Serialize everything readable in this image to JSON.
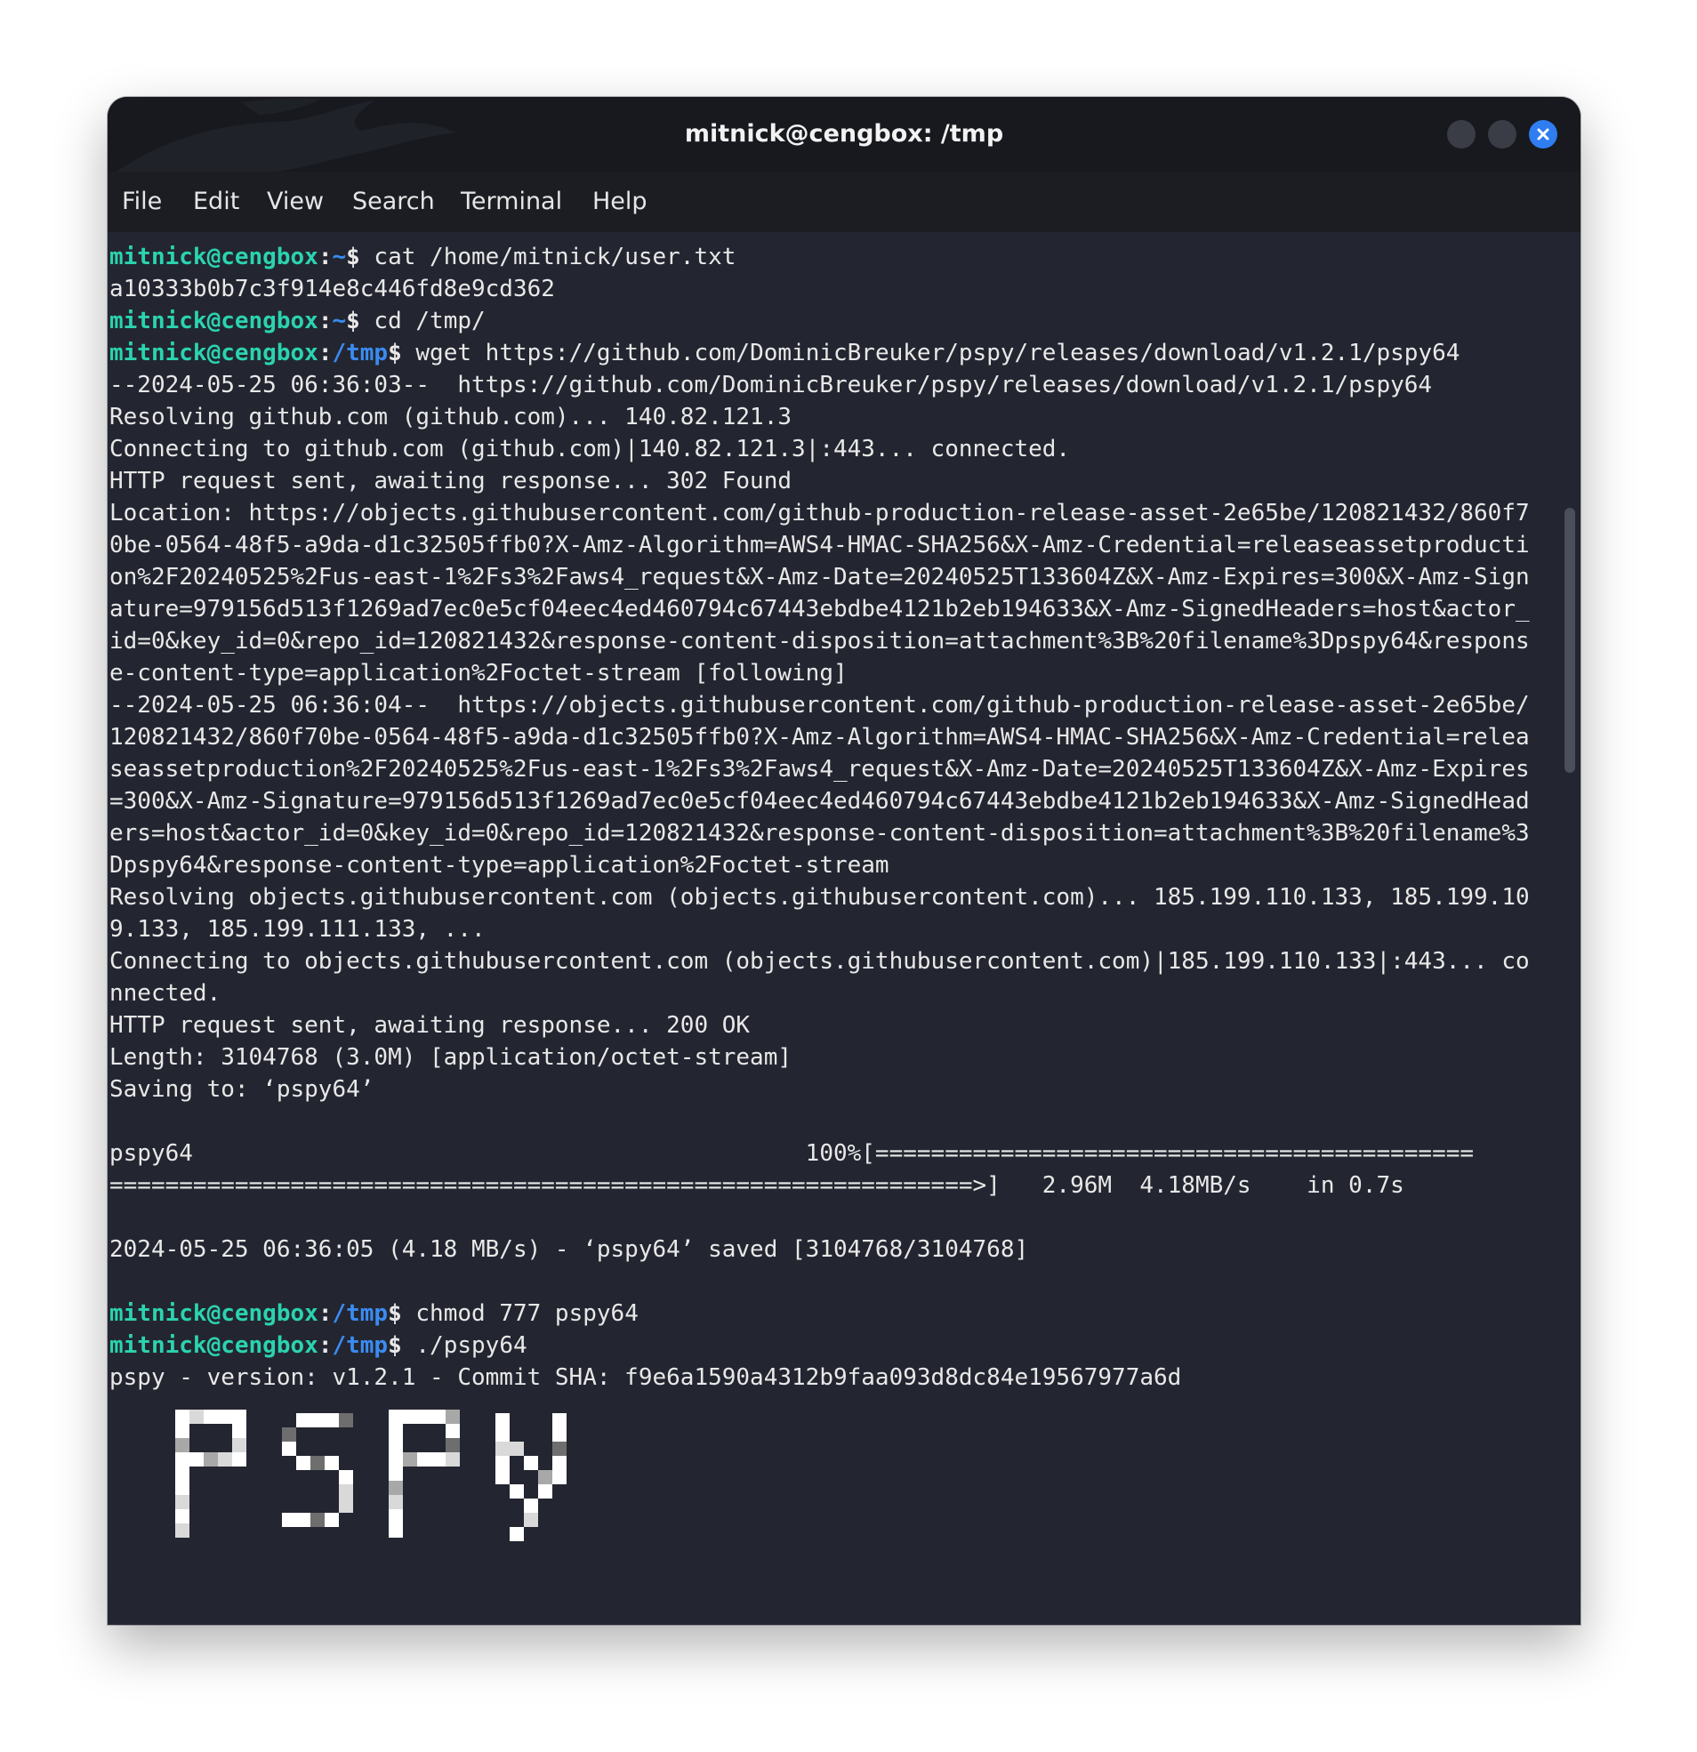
{
  "window": {
    "title": "mitnick@cengbox: /tmp",
    "accent_color": "#2f7df0"
  },
  "menu": [
    "File",
    "Edit",
    "View",
    "Search",
    "Terminal",
    "Help"
  ],
  "terminal": {
    "prompt_user": "mitnick@cengbox",
    "prompt_color": "#2bd3b0",
    "path_color": "#3b8bf2",
    "lines": [
      {
        "type": "prompt",
        "path": "~",
        "cmd": " cat /home/mitnick/user.txt"
      },
      {
        "type": "out",
        "text": "a10333b0b7c3f914e8c446fd8e9cd362"
      },
      {
        "type": "prompt",
        "path": "~",
        "cmd": " cd /tmp/"
      },
      {
        "type": "prompt",
        "path": "/tmp",
        "cmd": " wget https://github.com/DominicBreuker/pspy/releases/download/v1.2.1/pspy64"
      },
      {
        "type": "out",
        "text": "--2024-05-25 06:36:03--  https://github.com/DominicBreuker/pspy/releases/download/v1.2.1/pspy64"
      },
      {
        "type": "out",
        "text": "Resolving github.com (github.com)... 140.82.121.3"
      },
      {
        "type": "out",
        "text": "Connecting to github.com (github.com)|140.82.121.3|:443... connected."
      },
      {
        "type": "out",
        "text": "HTTP request sent, awaiting response... 302 Found"
      },
      {
        "type": "out",
        "text": "Location: https://objects.githubusercontent.com/github-production-release-asset-2e65be/120821432/860f7"
      },
      {
        "type": "out",
        "text": "0be-0564-48f5-a9da-d1c32505ffb0?X-Amz-Algorithm=AWS4-HMAC-SHA256&X-Amz-Credential=releaseassetproducti"
      },
      {
        "type": "out",
        "text": "on%2F20240525%2Fus-east-1%2Fs3%2Faws4_request&X-Amz-Date=20240525T133604Z&X-Amz-Expires=300&X-Amz-Sign"
      },
      {
        "type": "out",
        "text": "ature=979156d513f1269ad7ec0e5cf04eec4ed460794c67443ebdbe4121b2eb194633&X-Amz-SignedHeaders=host&actor_"
      },
      {
        "type": "out",
        "text": "id=0&key_id=0&repo_id=120821432&response-content-disposition=attachment%3B%20filename%3Dpspy64&respons"
      },
      {
        "type": "out",
        "text": "e-content-type=application%2Foctet-stream [following]"
      },
      {
        "type": "out",
        "text": "--2024-05-25 06:36:04--  https://objects.githubusercontent.com/github-production-release-asset-2e65be/"
      },
      {
        "type": "out",
        "text": "120821432/860f70be-0564-48f5-a9da-d1c32505ffb0?X-Amz-Algorithm=AWS4-HMAC-SHA256&X-Amz-Credential=relea"
      },
      {
        "type": "out",
        "text": "seassetproduction%2F20240525%2Fus-east-1%2Fs3%2Faws4_request&X-Amz-Date=20240525T133604Z&X-Amz-Expires"
      },
      {
        "type": "out",
        "text": "=300&X-Amz-Signature=979156d513f1269ad7ec0e5cf04eec4ed460794c67443ebdbe4121b2eb194633&X-Amz-SignedHead"
      },
      {
        "type": "out",
        "text": "ers=host&actor_id=0&key_id=0&repo_id=120821432&response-content-disposition=attachment%3B%20filename%3"
      },
      {
        "type": "out",
        "text": "Dpspy64&response-content-type=application%2Foctet-stream"
      },
      {
        "type": "out",
        "text": "Resolving objects.githubusercontent.com (objects.githubusercontent.com)... 185.199.110.133, 185.199.10"
      },
      {
        "type": "out",
        "text": "9.133, 185.199.111.133, ..."
      },
      {
        "type": "out",
        "text": "Connecting to objects.githubusercontent.com (objects.githubusercontent.com)|185.199.110.133|:443... co"
      },
      {
        "type": "out",
        "text": "nnected."
      },
      {
        "type": "out",
        "text": "HTTP request sent, awaiting response... 200 OK"
      },
      {
        "type": "out",
        "text": "Length: 3104768 (3.0M) [application/octet-stream]"
      },
      {
        "type": "out",
        "text": "Saving to: ‘pspy64’"
      },
      {
        "type": "out",
        "text": ""
      },
      {
        "type": "out",
        "text": "pspy64                                            100%[==========================================="
      },
      {
        "type": "out",
        "text": "==============================================================>]   2.96M  4.18MB/s    in 0.7s"
      },
      {
        "type": "out",
        "text": ""
      },
      {
        "type": "out",
        "text": "2024-05-25 06:36:05 (4.18 MB/s) - ‘pspy64’ saved [3104768/3104768]"
      },
      {
        "type": "out",
        "text": ""
      },
      {
        "type": "prompt",
        "path": "/tmp",
        "cmd": " chmod 777 pspy64"
      },
      {
        "type": "prompt",
        "path": "/tmp",
        "cmd": " ./pspy64"
      },
      {
        "type": "out",
        "text": "pspy - version: v1.2.1 - Commit SHA: f9e6a1590a4312b9faa093d8dc84e19567977a6d"
      }
    ],
    "banner_text": "PSPY"
  }
}
